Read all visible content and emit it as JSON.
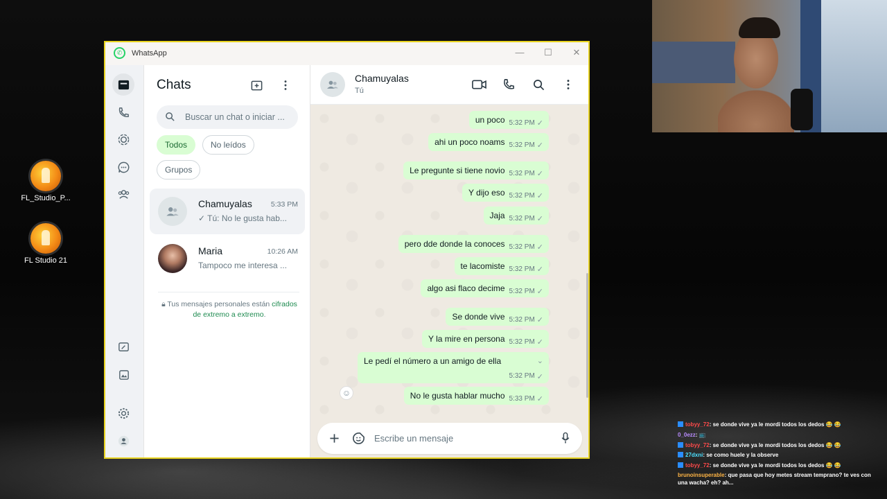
{
  "window": {
    "title": "WhatsApp"
  },
  "desktop": {
    "icons": [
      {
        "label": "FL_Studio_P..."
      },
      {
        "label": "FL Studio 21"
      }
    ]
  },
  "chats_panel": {
    "heading": "Chats",
    "search_placeholder": "Buscar un chat o iniciar ...",
    "filters": [
      "Todos",
      "No leídos",
      "Grupos"
    ],
    "active_filter": "Todos",
    "items": [
      {
        "name": "Chamuyalas",
        "time": "5:33 PM",
        "preview": "✓ Tú: No le gusta hab..."
      },
      {
        "name": "Maria",
        "time": "10:26 AM",
        "preview": "Tampoco me interesa ..."
      }
    ],
    "encryption_notice": "Tus mensajes personales están",
    "encryption_link": "cifrados de extremo a extremo",
    "encryption_end": "."
  },
  "conversation": {
    "name": "Chamuyalas",
    "subtitle": "Tú",
    "messages": [
      {
        "text": "un poco",
        "time": "5:32 PM"
      },
      {
        "text": "ahi un poco noams",
        "time": "5:32 PM"
      },
      {
        "text": "Le pregunte si tiene novio",
        "time": "5:32 PM"
      },
      {
        "text": "Y dijo eso",
        "time": "5:32 PM"
      },
      {
        "text": "Jaja",
        "time": "5:32 PM"
      },
      {
        "text": "pero dde donde la conoces",
        "time": "5:32 PM"
      },
      {
        "text": "te lacomiste",
        "time": "5:32 PM"
      },
      {
        "text": "algo asi flaco decime",
        "time": "5:32 PM"
      },
      {
        "text": "Se donde vive",
        "time": "5:32 PM"
      },
      {
        "text": "Y la mire en persona",
        "time": "5:32 PM"
      },
      {
        "text": "Le pedí el número a un amigo de ella",
        "time": "5:32 PM"
      },
      {
        "text": "No le gusta hablar mucho",
        "time": "5:33 PM"
      }
    ],
    "composer_placeholder": "Escribe un mensaje"
  },
  "stream_chat": [
    {
      "user": "tobyy_72",
      "user_color": "#ff4a4a",
      "text": ": se donde vive ya le mordi todos los dedos 😂 😂"
    },
    {
      "user": "0_0ezz",
      "user_color": "#b98cff",
      "text": ": 📺"
    },
    {
      "user": "tobyy_72",
      "user_color": "#ff4a4a",
      "text": ": se donde vive ya le mordi todos los dedos 😂 😂"
    },
    {
      "user": "27dxni",
      "user_color": "#4de0ff",
      "text": ": se como huele y la observe"
    },
    {
      "user": "tobyy_72",
      "user_color": "#ff4a4a",
      "text": ": se donde vive ya le mordi todos los dedos 😂 😂"
    },
    {
      "user": "brunoinsuperable",
      "user_color": "#ffb545",
      "text": ": que pasa que hoy metes stream temprano? te ves con una wacha? eh? ah..."
    }
  ],
  "colors": {
    "bubble_out": "#d9fdd3",
    "accent": "#25d366",
    "window_border": "#e8d31f"
  }
}
